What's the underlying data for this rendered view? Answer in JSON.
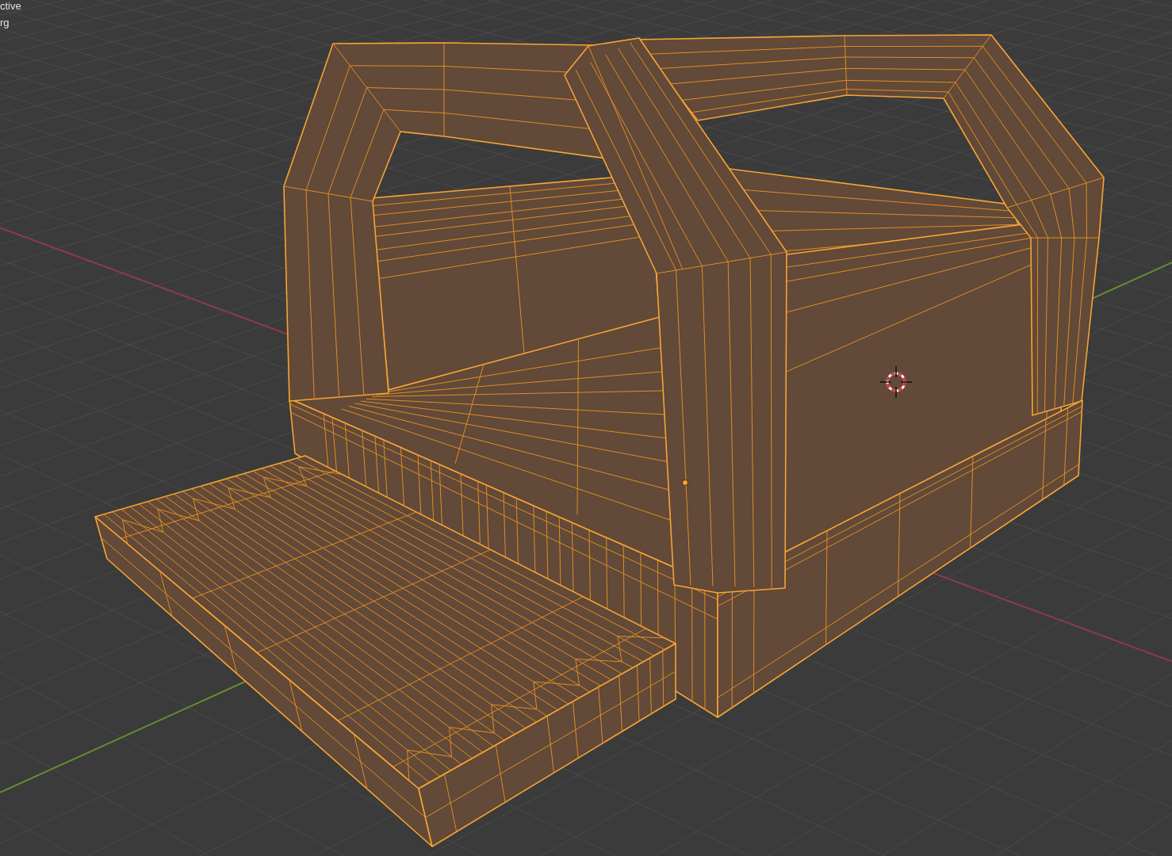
{
  "viewport": {
    "info_lines": [
      "ctive",
      "rg"
    ]
  },
  "object": {
    "selected": true
  }
}
